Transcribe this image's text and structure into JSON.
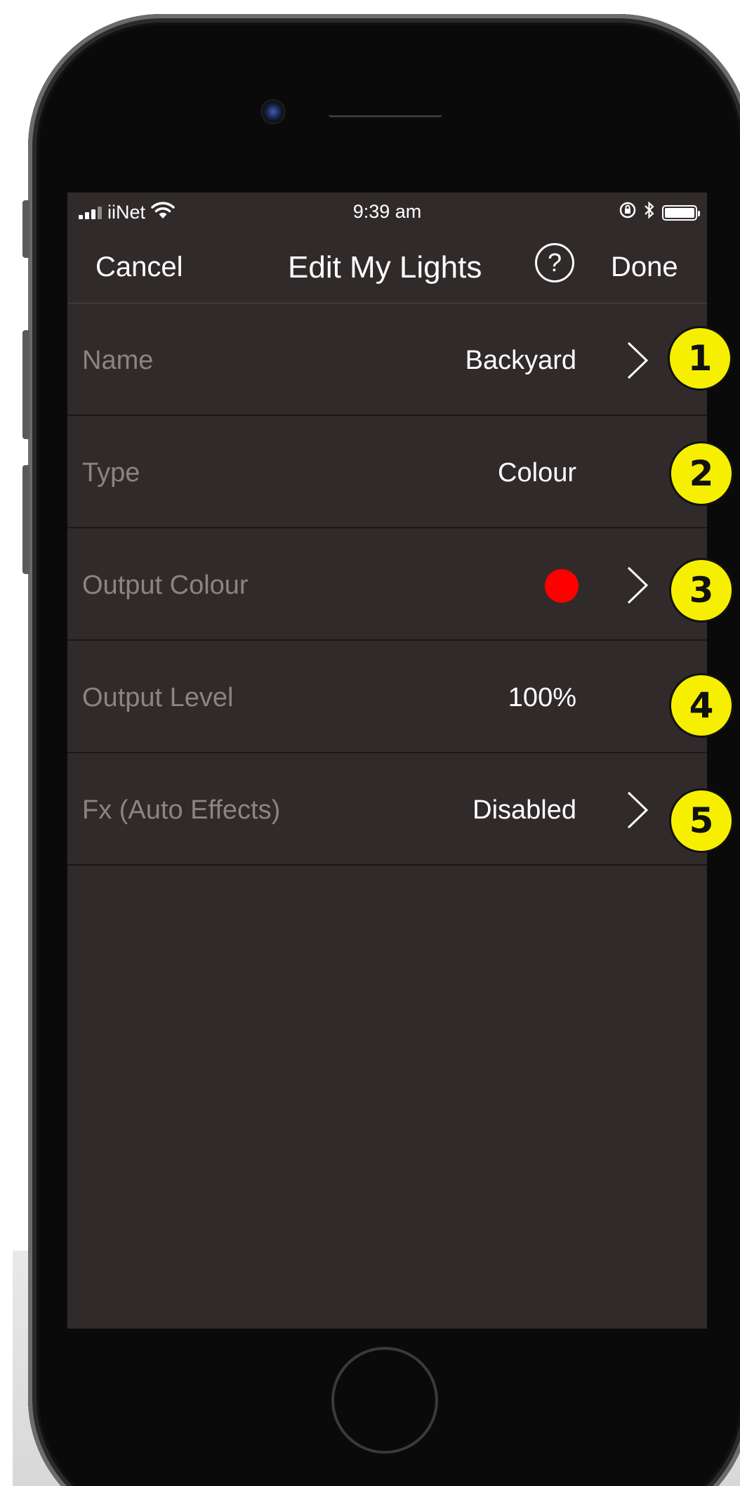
{
  "status_bar": {
    "carrier": "iiNet",
    "time": "9:39 am",
    "icons": [
      "signal-icon",
      "wifi-icon",
      "orientation-lock-icon",
      "bluetooth-icon",
      "battery-icon"
    ]
  },
  "nav": {
    "cancel_label": "Cancel",
    "title": "Edit My Lights",
    "help_label": "?",
    "done_label": "Done"
  },
  "rows": [
    {
      "label": "Name",
      "value": "Backyard",
      "has_chevron": true
    },
    {
      "label": "Type",
      "value": "Colour",
      "has_chevron": false
    },
    {
      "label": "Output Colour",
      "value_color": "#ff0000",
      "has_chevron": true
    },
    {
      "label": "Output Level",
      "value": "100%",
      "has_chevron": false
    },
    {
      "label": "Fx (Auto Effects)",
      "value": "Disabled",
      "has_chevron": true
    }
  ],
  "callouts": [
    "1",
    "2",
    "3",
    "4",
    "5"
  ],
  "colors": {
    "background": "#302b2a",
    "label": "#8a8584",
    "value": "#ffffff",
    "callout": "#f6f000"
  }
}
